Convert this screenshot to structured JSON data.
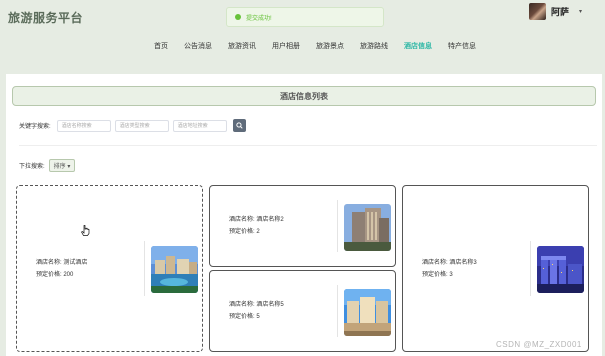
{
  "header": {
    "brand": "旅游服务平台",
    "toast": "提交成功!",
    "user_name": "阿萨",
    "caret": "▾"
  },
  "nav": {
    "items": [
      "首页",
      "公告消息",
      "旅游资讯",
      "用户相册",
      "旅游景点",
      "旅游路线",
      "酒店信息",
      "特产信息"
    ],
    "active": "酒店信息"
  },
  "page": {
    "title": "酒店信息列表",
    "keyword_label": "关键字搜索:",
    "search_placeholders": [
      "酒店名称搜索",
      "酒店类型搜索",
      "酒店地址搜索"
    ],
    "dropdown_label": "下拉搜索:",
    "sort_label": "排序 ▾"
  },
  "cards": [
    {
      "name_line": "酒店名称: 测试酒店",
      "price_line": "预定价格: 200",
      "image": "hotel-resort-photo"
    },
    {
      "name_line": "酒店名称: 酒店名称2",
      "price_line": "预定价格: 2",
      "image": "hotel-tower-photo"
    },
    {
      "name_line": "酒店名称: 酒店名称5",
      "price_line": "预定价格: 5",
      "image": "hotel-palace-photo"
    },
    {
      "name_line": "酒店名称: 酒店名称3",
      "price_line": "预定价格: 3",
      "image": "hotel-skyline-night-photo"
    }
  ],
  "watermark": "CSDN @MZ_ZXD001",
  "colors": {
    "page_bg": "#e6ece3",
    "active_nav": "#2db7a5",
    "toast_green": "#67c23a",
    "title_bar_bg": "#eaf1e6",
    "search_button": "#5f6b7a"
  }
}
